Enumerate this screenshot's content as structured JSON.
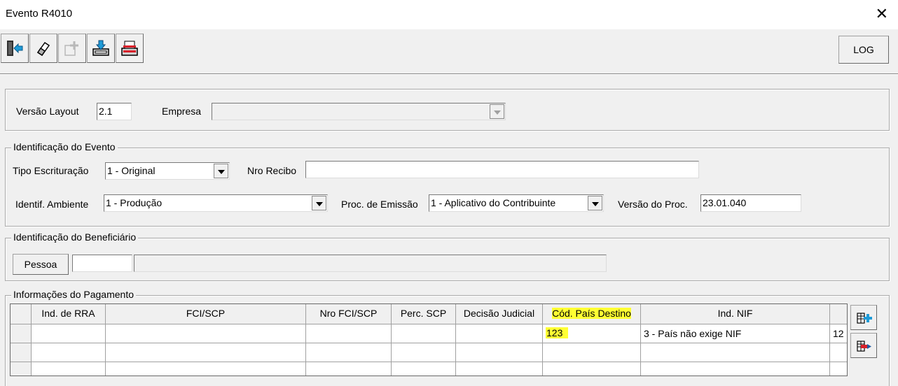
{
  "window": {
    "title": "Evento R4010"
  },
  "toolbar": {
    "buttons": [
      {
        "name": "exit-icon"
      },
      {
        "name": "eraser-icon"
      },
      {
        "name": "add-disabled-icon"
      },
      {
        "name": "save-download-icon"
      },
      {
        "name": "folder-open-icon"
      }
    ],
    "log_label": "LOG"
  },
  "header": {
    "versao_label": "Versão Layout",
    "versao_value": "2.1",
    "empresa_label": "Empresa",
    "empresa_value": ""
  },
  "evento": {
    "legend": "Identificação do Evento",
    "tipo_label": "Tipo Escrituração",
    "tipo_value": "1 - Original",
    "recibo_label": "Nro Recibo",
    "recibo_value": "",
    "ambiente_label": "Identif. Ambiente",
    "ambiente_value": "1 - Produção",
    "proc_label": "Proc. de Emissão",
    "proc_value": "1 - Aplicativo do Contribuinte",
    "versao_proc_label": "Versão do Proc.",
    "versao_proc_value": "23.01.040"
  },
  "beneficiario": {
    "legend": "Identificação do Beneficiário",
    "pessoa_label": "Pessoa",
    "pessoa_code": "",
    "pessoa_name": ""
  },
  "pagamento": {
    "legend": "Informações do Pagamento",
    "columns": [
      "Ind. de RRA",
      "FCI/SCP",
      "Nro FCI/SCP",
      "Perc. SCP",
      "Decisão Judicial",
      "Cód. País Destino",
      "Ind. NIF",
      ""
    ],
    "rows": [
      [
        "",
        "",
        "",
        "",
        "",
        "123",
        "3 - País não exige NIF",
        "12"
      ],
      [
        "",
        "",
        "",
        "",
        "",
        "",
        "",
        ""
      ],
      [
        "",
        "",
        "",
        "",
        "",
        "",
        "",
        ""
      ]
    ],
    "highlight_color": "#ffff33"
  }
}
